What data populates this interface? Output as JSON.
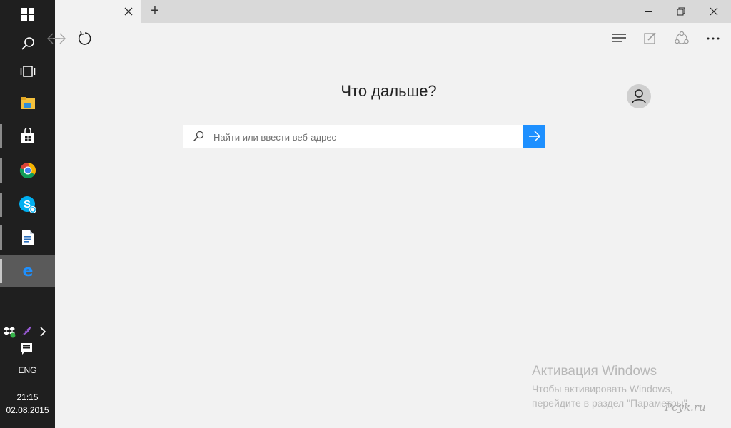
{
  "taskbar": {
    "language": "ENG",
    "time": "21:15",
    "date": "02.08.2015",
    "apps": [
      "windows-start",
      "search",
      "task-view",
      "file-explorer",
      "store",
      "chrome",
      "skype",
      "writer",
      "edge"
    ],
    "tray": [
      "dropbox",
      "feather",
      "chevron",
      "notification-center"
    ]
  },
  "browser": {
    "new_tab_symbol": "+",
    "page_title": "Что дальше?",
    "search_placeholder": "Найти или ввести веб-адрес",
    "accent_color": "#1e90ff"
  },
  "activation": {
    "title": "Активация Windows",
    "line1": "Чтобы активировать Windows,",
    "line2": "перейдите в раздел \"Параметры\"."
  },
  "watermark": "Pcyk.ru"
}
